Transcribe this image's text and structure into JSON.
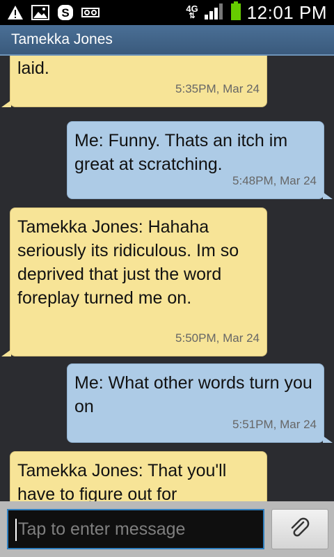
{
  "status_bar": {
    "network": "4G",
    "time": "12:01 PM",
    "icons": [
      "warning-icon",
      "image-icon",
      "skype-icon",
      "voicemail-icon",
      "signal-icon",
      "battery-icon"
    ]
  },
  "header": {
    "contact_name": "Tamekka Jones"
  },
  "messages": [
    {
      "direction": "incoming",
      "text": "laid.",
      "timestamp": "5:35PM, Mar 24"
    },
    {
      "direction": "outgoing",
      "text": "Me: Funny. Thats an itch im great at scratching.",
      "timestamp": "5:48PM, Mar 24"
    },
    {
      "direction": "incoming",
      "text": "Tamekka Jones: Hahaha seriously its ridiculous.  Im so deprived that just the word foreplay turned me on.",
      "timestamp": "5:50PM, Mar 24"
    },
    {
      "direction": "outgoing",
      "text": "Me: What other words turn you on",
      "timestamp": "5:51PM, Mar 24"
    },
    {
      "direction": "incoming",
      "text": "Tamekka Jones: That you'll have to figure out for",
      "timestamp": ""
    }
  ],
  "compose": {
    "placeholder": "Tap to enter message",
    "attach_icon": "paperclip-icon"
  },
  "colors": {
    "incoming_bubble": "#f7e497",
    "outgoing_bubble": "#adcbe6",
    "titlebar": "#3a5a7c",
    "background": "#2b2c30",
    "input_border": "#2f7fbf"
  }
}
